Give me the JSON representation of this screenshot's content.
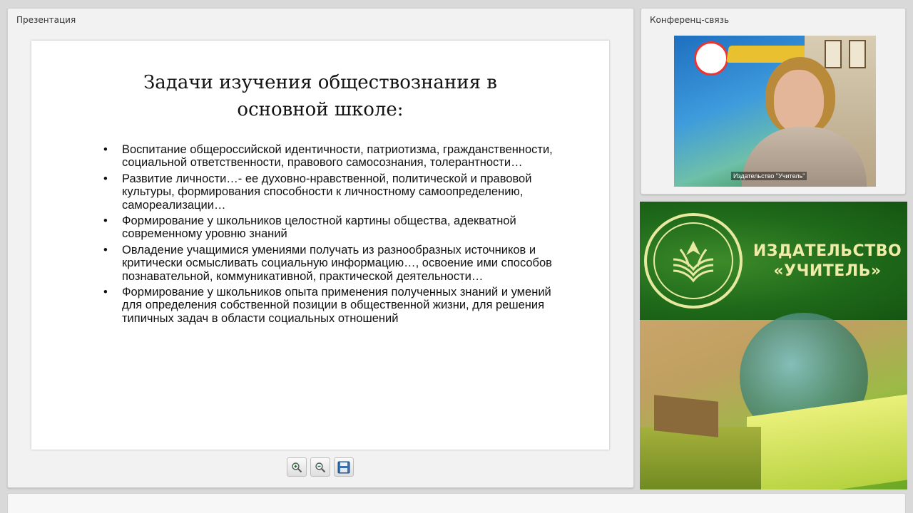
{
  "presentation": {
    "panel_title": "Презентация",
    "slide": {
      "title": "Задачи изучения обществознания в основной школе:",
      "bullets": [
        "Воспитание общероссийской идентичности, патриотизма, гражданственности, социальной ответственности, правового самосознания, толерантности…",
        "Развитие личности…- ее духовно-нравственной, политической и правовой культуры, формирования способности к личностному самоопределению, самореализации…",
        "Формирование у школьников целостной картины общества, адекватной современному уровню знаний",
        "Овладение учащимися умениями получать из разнообразных источников и критически осмысливать социальную информацию…, освоение ими способов познавательной, коммуникативной, практической деятельности…",
        "Формирование у школьников опыта применения полученных знаний и умений для определения собственной позиции в общественной жизни, для решения типичных задач в области социальных отношений"
      ]
    },
    "toolbar": {
      "zoom_in_icon": "zoom-in-icon",
      "zoom_out_icon": "zoom-out-icon",
      "save_icon": "floppy-disk-icon"
    }
  },
  "conference": {
    "panel_title": "Конференц-связь",
    "video_caption": "Издательство \"Учитель\""
  },
  "publisher": {
    "name_line1": "ИЗДАТЕЛЬСТВО",
    "name_line2": "«УЧИТЕЛЬ»",
    "colors": {
      "background": "#1d6a1b",
      "text": "#f0eca8"
    }
  }
}
